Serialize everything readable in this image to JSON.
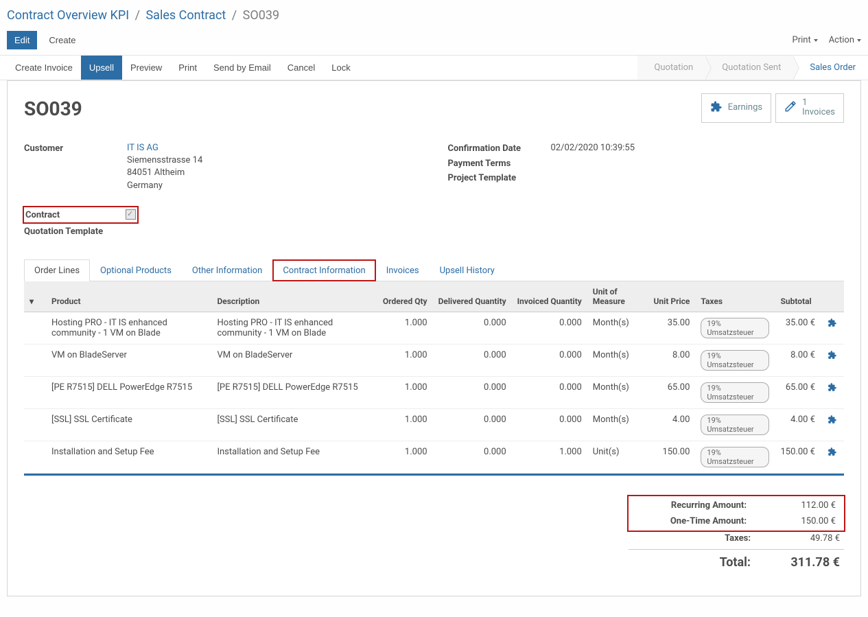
{
  "breadcrumb": {
    "level1": "Contract Overview KPI",
    "level2": "Sales Contract",
    "current": "SO039"
  },
  "topbar": {
    "edit": "Edit",
    "create": "Create",
    "print": "Print",
    "action": "Action"
  },
  "statusbar": {
    "create_invoice": "Create Invoice",
    "upsell": "Upsell",
    "preview": "Preview",
    "print": "Print",
    "send_email": "Send by Email",
    "cancel": "Cancel",
    "lock": "Lock",
    "step_quotation": "Quotation",
    "step_quotation_sent": "Quotation Sent",
    "step_sales_order": "Sales Order"
  },
  "stat_buttons": {
    "earnings": "Earnings",
    "invoices_count": "1",
    "invoices_label": "Invoices"
  },
  "title": "SO039",
  "left_fields": {
    "customer_label": "Customer",
    "customer_name": "IT IS AG",
    "customer_street": "Siemensstrasse 14",
    "customer_city": "84051 Altheim",
    "customer_country": "Germany",
    "contract_label": "Contract",
    "quotation_template_label": "Quotation Template"
  },
  "right_fields": {
    "confirmation_date_label": "Confirmation Date",
    "confirmation_date_value": "02/02/2020 10:39:55",
    "payment_terms_label": "Payment Terms",
    "project_template_label": "Project Template"
  },
  "tabs": {
    "order_lines": "Order Lines",
    "optional_products": "Optional Products",
    "other_information": "Other Information",
    "contract_information": "Contract Information",
    "invoices": "Invoices",
    "upsell_history": "Upsell History"
  },
  "columns": {
    "product": "Product",
    "description": "Description",
    "ordered_qty": "Ordered Qty",
    "delivered_qty": "Delivered Quantity",
    "invoiced_qty": "Invoiced Quantity",
    "uom": "Unit of Measure",
    "unit_price": "Unit Price",
    "taxes": "Taxes",
    "subtotal": "Subtotal"
  },
  "lines": [
    {
      "product": "Hosting PRO - IT IS enhanced community - 1 VM on Blade",
      "description": "Hosting PRO - IT IS enhanced community - 1 VM on Blade",
      "ordered": "1.000",
      "delivered": "0.000",
      "invoiced": "0.000",
      "uom": "Month(s)",
      "price": "35.00",
      "tax": "19% Umsatzsteuer",
      "subtotal": "35.00 €"
    },
    {
      "product": "VM on BladeServer",
      "description": "VM on BladeServer",
      "ordered": "1.000",
      "delivered": "0.000",
      "invoiced": "0.000",
      "uom": "Month(s)",
      "price": "8.00",
      "tax": "19% Umsatzsteuer",
      "subtotal": "8.00 €"
    },
    {
      "product": "[PE R7515] DELL PowerEdge R7515",
      "description": "[PE R7515] DELL PowerEdge R7515",
      "ordered": "1.000",
      "delivered": "0.000",
      "invoiced": "0.000",
      "uom": "Month(s)",
      "price": "65.00",
      "tax": "19% Umsatzsteuer",
      "subtotal": "65.00 €"
    },
    {
      "product": "[SSL] SSL Certificate",
      "description": "[SSL] SSL Certificate",
      "ordered": "1.000",
      "delivered": "0.000",
      "invoiced": "0.000",
      "uom": "Month(s)",
      "price": "4.00",
      "tax": "19% Umsatzsteuer",
      "subtotal": "4.00 €"
    },
    {
      "product": "Installation and Setup Fee",
      "description": "Installation and Setup Fee",
      "ordered": "1.000",
      "delivered": "0.000",
      "invoiced": "1.000",
      "uom": "Unit(s)",
      "price": "150.00",
      "tax": "19% Umsatzsteuer",
      "subtotal": "150.00 €"
    }
  ],
  "totals": {
    "recurring_label": "Recurring Amount:",
    "recurring_value": "112.00 €",
    "onetime_label": "One-Time Amount:",
    "onetime_value": "150.00 €",
    "taxes_label": "Taxes:",
    "taxes_value": "49.78 €",
    "total_label": "Total:",
    "total_value": "311.78 €"
  }
}
